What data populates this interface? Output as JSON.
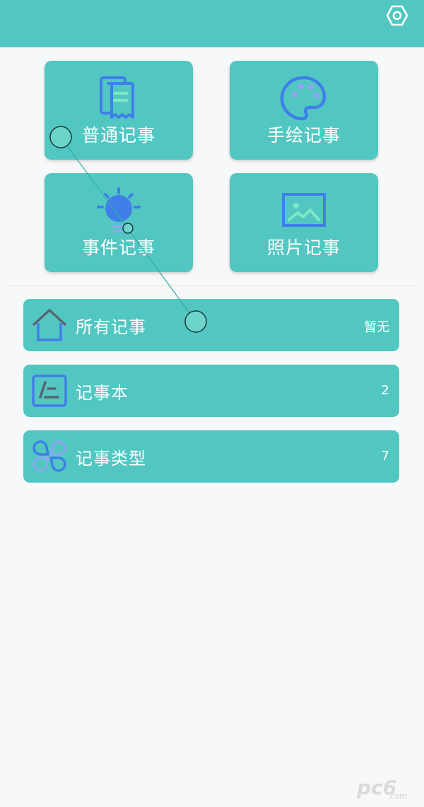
{
  "header": {
    "settings_icon": "hexagon-settings-icon"
  },
  "tiles": [
    {
      "label": "普通记事",
      "icon": "notes-icon"
    },
    {
      "label": "手绘记事",
      "icon": "palette-icon"
    },
    {
      "label": "事件记事",
      "icon": "lightbulb-icon"
    },
    {
      "label": "照片记事",
      "icon": "image-icon"
    }
  ],
  "rows": [
    {
      "label": "所有记事",
      "value": "暂无",
      "icon": "home-icon"
    },
    {
      "label": "记事本",
      "value": "2",
      "icon": "notebook-icon"
    },
    {
      "label": "记事类型",
      "value": "7",
      "icon": "grid-petals-icon"
    }
  ],
  "watermark": {
    "logo": "pc6",
    "text": ".com"
  },
  "colors": {
    "primary": "#52c7c2",
    "background": "#f7f8f9",
    "icon_blue": "#3f7fe8"
  }
}
